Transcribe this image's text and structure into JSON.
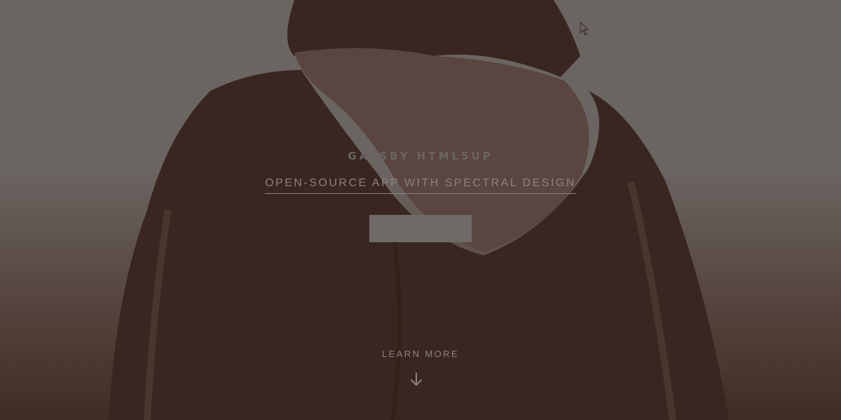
{
  "hero": {
    "title": "GATSBY HTML5UP",
    "subtitle": "OPEN-SOURCE APP WITH SPECTRAL DESIGN",
    "cta_label": "",
    "learn_more": "LEARN MORE",
    "arrow_icon": "arrow-down-icon",
    "cursor_icon": "mouse-pointer-icon"
  },
  "colors": {
    "background": "#6b6562",
    "figure": "#3a2620",
    "text": "#8a8380",
    "button": "#706a67"
  }
}
